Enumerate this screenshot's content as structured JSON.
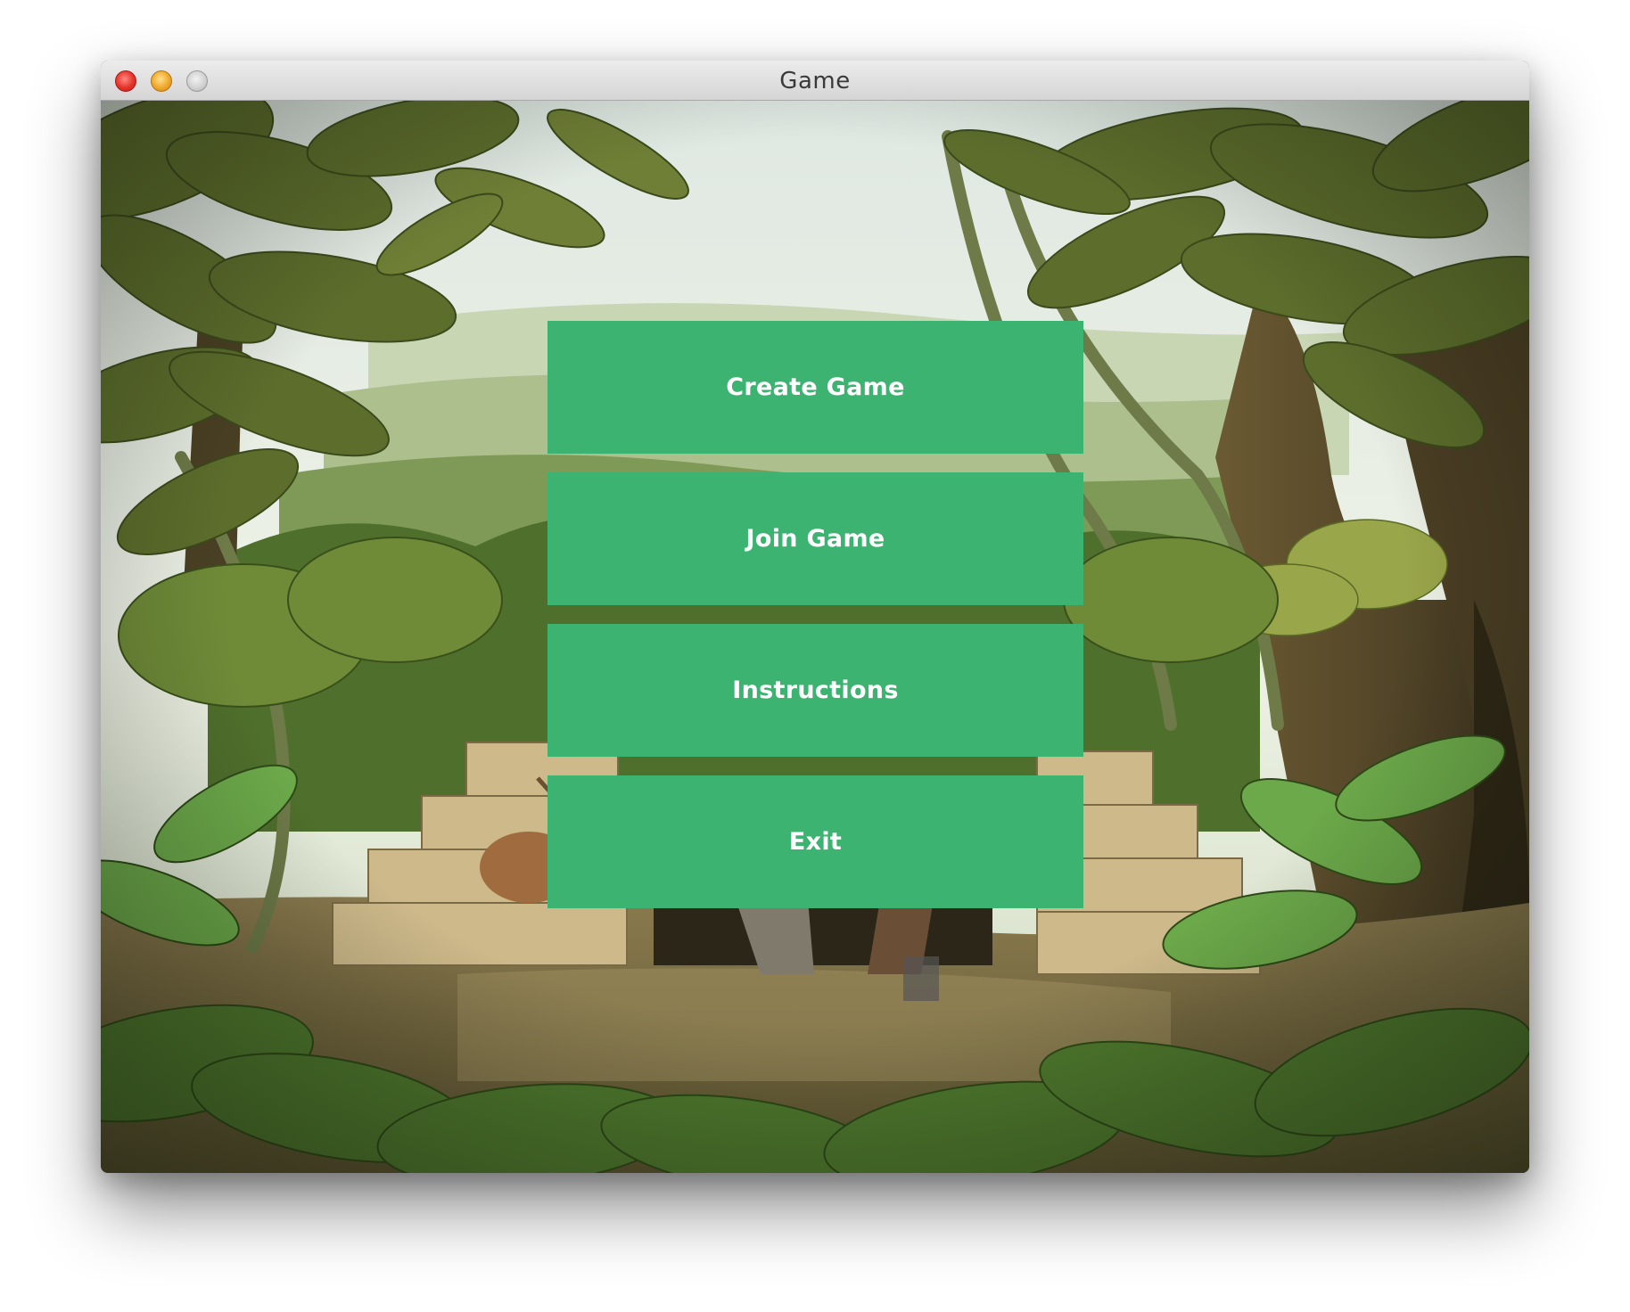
{
  "window": {
    "title": "Game"
  },
  "menu": {
    "buttons": [
      {
        "label": "Create Game"
      },
      {
        "label": "Join Game"
      },
      {
        "label": "Instructions"
      },
      {
        "label": "Exit"
      }
    ],
    "button_color": "#3cb371",
    "text_color": "#ffffff"
  }
}
